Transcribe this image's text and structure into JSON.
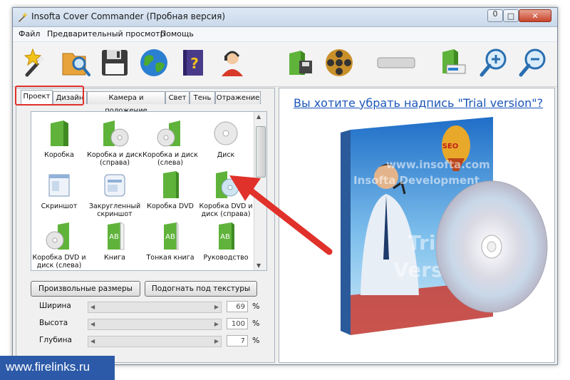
{
  "window": {
    "title": "Insofta Cover Commander (Пробная версия)",
    "controls": {
      "minimize": "0",
      "maximize": "□",
      "close": "✕"
    }
  },
  "menu": [
    "Файл",
    "Предварительный просмотр",
    "Помощь"
  ],
  "toolbar_icons": [
    "magic-wand-icon",
    "open-folder-icon",
    "save-disk-icon",
    "globe-icon",
    "help-book-icon",
    "support-agent-icon",
    "export-box-icon",
    "film-reel-icon",
    "blank-button-icon",
    "render-box-icon",
    "zoom-in-icon",
    "zoom-out-icon"
  ],
  "tabs": [
    "Проект",
    "Дизайн",
    "Камера и положение",
    "Свет",
    "Тень",
    "Отражение"
  ],
  "active_tab": "Проект",
  "items": [
    {
      "label": "Коробка",
      "icon": "green-box-icon"
    },
    {
      "label": "Коробка и диск (справа)",
      "icon": "box-disc-right-icon"
    },
    {
      "label": "Коробка и диск (слева)",
      "icon": "box-disc-left-icon"
    },
    {
      "label": "Диск",
      "icon": "disc-icon"
    },
    {
      "label": "Скриншот",
      "icon": "screenshot-icon"
    },
    {
      "label": "Закругленный скриншот",
      "icon": "rounded-screenshot-icon"
    },
    {
      "label": "Коробка DVD",
      "icon": "dvd-box-icon"
    },
    {
      "label": "Коробка DVD и диск (справа)",
      "icon": "dvd-box-disc-icon"
    },
    {
      "label": "Коробка DVD и диск (слева)",
      "icon": "dvd-box-disc-left-icon"
    },
    {
      "label": "Книга",
      "icon": "book-icon"
    },
    {
      "label": "Тонкая книга",
      "icon": "thin-book-icon"
    },
    {
      "label": "Руководство",
      "icon": "manual-icon"
    }
  ],
  "buttons": {
    "custom_size": "Произвольные размеры",
    "fit_textures": "Подогнать под текстуры"
  },
  "dimensions": [
    {
      "label": "Ширина",
      "value": "69",
      "unit": "%"
    },
    {
      "label": "Высота",
      "value": "100",
      "unit": "%"
    },
    {
      "label": "Глубина",
      "value": "7",
      "unit": "%"
    }
  ],
  "preview": {
    "trial_link": "Вы хотите убрать надпись \"Trial version\"?",
    "watermark_lines": [
      "www.insofta.com",
      "Insofta Development"
    ],
    "trial_text": [
      "Trial",
      "Version"
    ],
    "balloon_text": "SEO"
  },
  "site_watermark": "www.firelinks.ru",
  "colors": {
    "accent_green": "#5fb33a",
    "link_blue": "#1b56b8",
    "arrow_red": "#e0312a",
    "watermark_bg": "#2d5aa8"
  }
}
